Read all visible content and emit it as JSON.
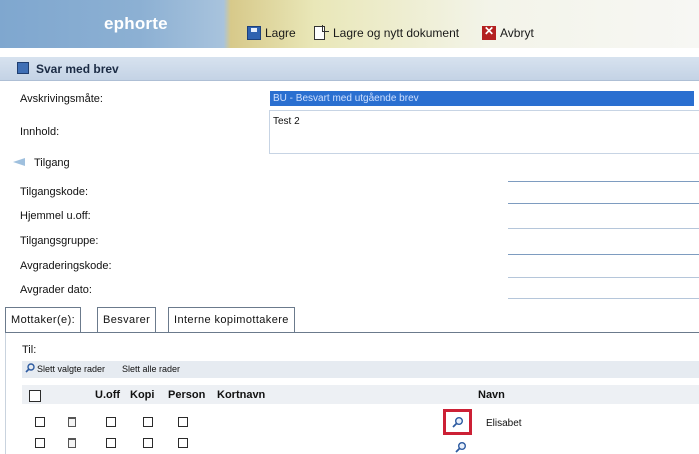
{
  "header": {
    "logo": "ephorte",
    "save_label": "Lagre",
    "save_new_label": "Lagre og nytt dokument",
    "cancel_label": "Avbryt"
  },
  "page": {
    "title": "Svar med brev"
  },
  "form": {
    "avskrivingsmate_label": "Avskrivingsmåte:",
    "avskrivingsmate_value": "BU - Besvart med utgående brev",
    "innhold_label": "Innhold:",
    "innhold_value": "Test 2",
    "tilgang_section": "Tilgang",
    "tilgangskode_label": "Tilgangskode:",
    "hjemmel_label": "Hjemmel u.off:",
    "tilgangsgruppe_label": "Tilgangsgruppe:",
    "avgraderingskode_label": "Avgraderingskode:",
    "avgrader_dato_label": "Avgrader dato:"
  },
  "tabs": [
    {
      "label": "Mottaker(e):"
    },
    {
      "label": "Besvarer"
    },
    {
      "label": "Interne kopimottakere"
    }
  ],
  "recipients": {
    "til_label": "Til:",
    "delete_selected": "Slett valgte rader",
    "delete_all": "Slett alle rader",
    "columns": {
      "uoff": "U.off",
      "kopi": "Kopi",
      "person": "Person",
      "kortnavn": "Kortnavn",
      "navn": "Navn"
    },
    "rows": [
      {
        "navn": "Elisabet"
      },
      {
        "navn": ""
      }
    ]
  }
}
